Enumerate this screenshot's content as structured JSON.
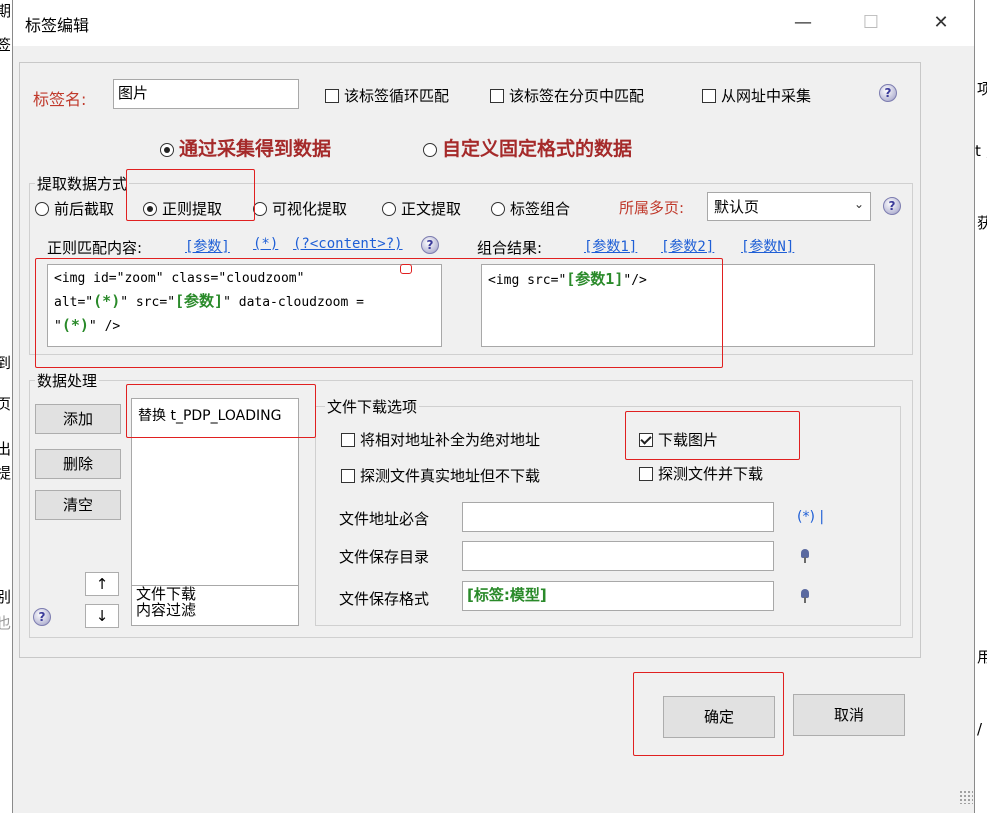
{
  "background": {
    "left_fragments": [
      "期",
      "签",
      "到",
      "页",
      "出",
      "提",
      "别",
      "也"
    ],
    "right_fragments": [
      "项",
      "t ,",
      "获",
      "用",
      "/"
    ]
  },
  "dialog": {
    "title": "标签编辑",
    "minimize_glyph": "—",
    "maximize_glyph": "☐",
    "close_glyph": "✕"
  },
  "tag": {
    "name_label": "标签名:",
    "name_value": "图片",
    "options": [
      {
        "label": "该标签循环匹配",
        "checked": false
      },
      {
        "label": "该标签在分页中匹配",
        "checked": false
      },
      {
        "label": "从网址中采集",
        "checked": false
      }
    ]
  },
  "source": {
    "collect_label": "通过采集得到数据",
    "collect_selected": true,
    "fixed_label": "自定义固定格式的数据",
    "fixed_selected": false
  },
  "extract": {
    "group_title": "提取数据方式",
    "methods": [
      {
        "label": "前后截取",
        "selected": false
      },
      {
        "label": "正则提取",
        "selected": true
      },
      {
        "label": "可视化提取",
        "selected": false
      },
      {
        "label": "正文提取",
        "selected": false
      },
      {
        "label": "标签组合",
        "selected": false
      }
    ],
    "page_label": "所属多页:",
    "page_value": "默认页",
    "regex_label": "正则匹配内容:",
    "regex_links": [
      "[参数]",
      "(*)",
      "(?<content>?)"
    ],
    "regex_text": {
      "l1": "<img id=\"zoom\" class=\"cloudzoom\"",
      "l2a": "alt=\"",
      "l2b": "(*)",
      "l2c": "\" src=\"",
      "l2d": "[参数]",
      "l2e": "\"  data-cloudzoom =",
      "l3a": "\"",
      "l3b": "(*)",
      "l3c": "\" />"
    },
    "combine_label": "组合结果:",
    "combine_links": [
      "[参数1]",
      "[参数2]",
      "[参数N]"
    ],
    "combine_text": {
      "a": "<img src=\"",
      "b": "[参数1]",
      "c": "\"/>"
    }
  },
  "processing": {
    "group_title": "数据处理",
    "buttons": {
      "add": "添加",
      "delete": "删除",
      "clear": "清空"
    },
    "list_items": [
      "替换 t_PDP_LOADING"
    ],
    "bottom_items": [
      "文件下载",
      "内容过滤"
    ],
    "up": "↑",
    "down": "↓"
  },
  "download": {
    "group_title": "文件下载选项",
    "opts": [
      {
        "label": "将相对地址补全为绝对地址",
        "checked": false
      },
      {
        "label": "下载图片",
        "checked": true
      },
      {
        "label": "探测文件真实地址但不下载",
        "checked": false
      },
      {
        "label": "探测文件并下载",
        "checked": false
      }
    ],
    "must_contain_label": "文件地址必含",
    "must_contain_value": "",
    "must_contain_hint": "(*) |",
    "save_dir_label": "文件保存目录",
    "save_dir_value": "",
    "save_fmt_label": "文件保存格式",
    "save_fmt_value": "[标签:模型]"
  },
  "footer": {
    "ok": "确定",
    "cancel": "取消"
  },
  "colors": {
    "highlight": "#e02020",
    "link": "#1f5fd6",
    "param": "#2a8a2a",
    "label_red": "#c0392b"
  }
}
